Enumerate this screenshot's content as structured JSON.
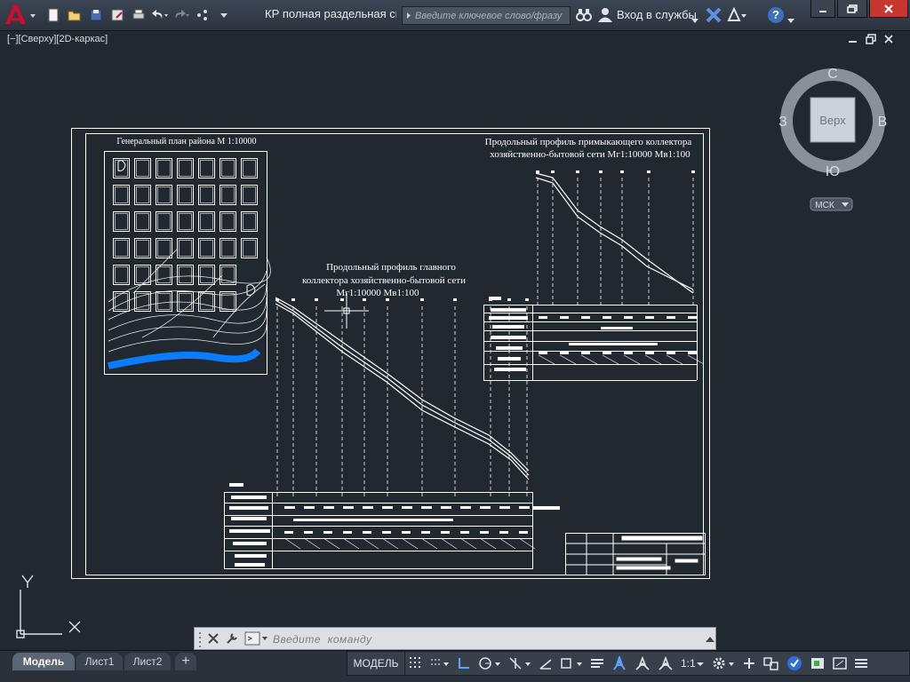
{
  "app": {
    "title": "КР полная раздельная сис...",
    "search_placeholder": "Введите ключевое слово/фразу",
    "signin_label": "Вход в службы",
    "help_label": "?"
  },
  "viewport": {
    "label": "[−][Сверху][2D-каркас]"
  },
  "viewcube": {
    "north": "С",
    "south": "Ю",
    "west": "З",
    "east": "В",
    "face": "Верх",
    "ucs_label": "МСК"
  },
  "drawing": {
    "plan_title": "Генеральный план района М 1:10000",
    "main_profile_title_1": "Продольный профиль главного",
    "main_profile_title_2": "коллектора хозяйственно-бытовой сети",
    "main_profile_title_3": "Мг1:10000 Мв1:100",
    "side_profile_title_1": "Продольный профиль примыкающего коллектора",
    "side_profile_title_2": "хозяйственно-бытовой сети Мг1:10000 Мв1:100"
  },
  "ucs": {
    "x_label": "X",
    "y_label": "Y"
  },
  "command": {
    "placeholder": "Введите  команду"
  },
  "layout_tabs": [
    "Модель",
    "Лист1",
    "Лист2"
  ],
  "status": {
    "model_label": "МОДЕЛЬ",
    "scale_label": "1:1"
  },
  "colors": {
    "accent_red": "#c8102e",
    "drawing_bg": "#212830",
    "river_blue": "#0a7cff"
  }
}
